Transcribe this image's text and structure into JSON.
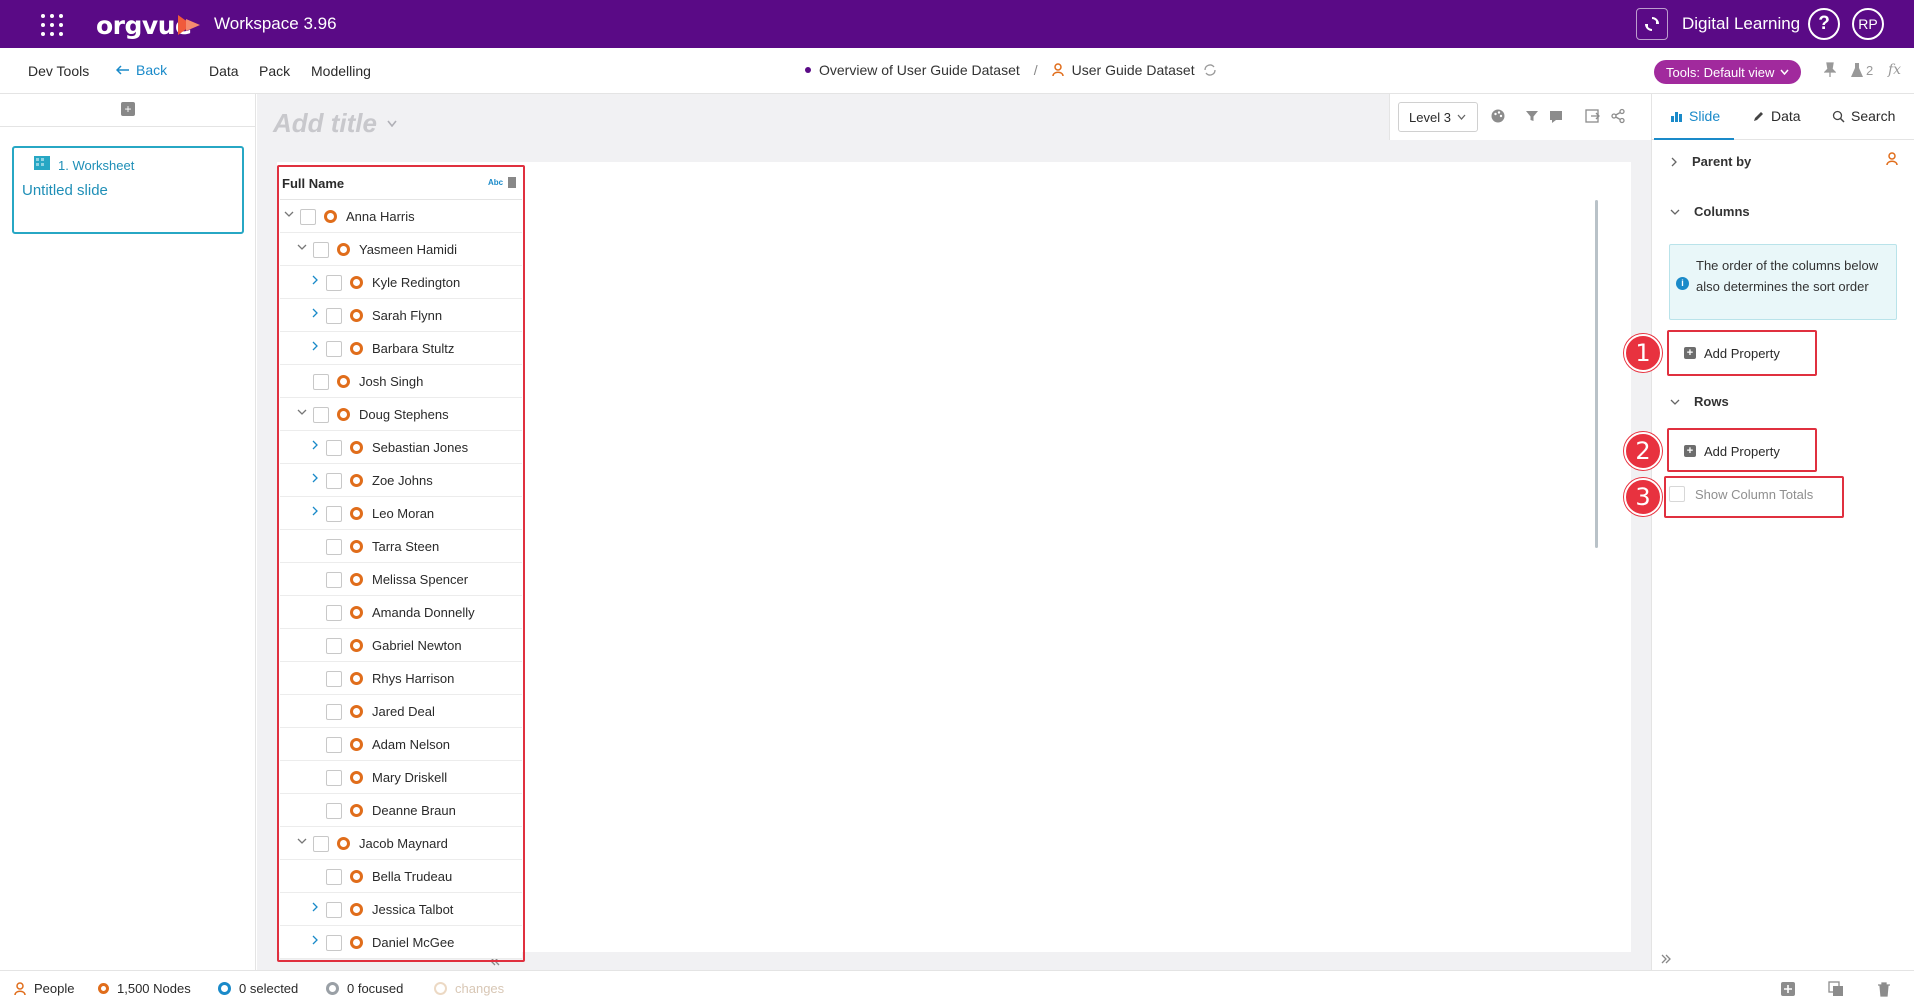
{
  "topbar": {
    "logo": "orgvue",
    "workspace": "Workspace  3.96",
    "org": "Digital Learning",
    "help": "?",
    "user_initials": "RP"
  },
  "menu": {
    "dev_tools": "Dev Tools",
    "back": "Back",
    "data": "Data",
    "pack": "Pack",
    "modelling": "Modelling",
    "breadcrumb_parent": "Overview of User Guide Dataset",
    "breadcrumb_sep": "/",
    "breadcrumb_current": "User Guide Dataset",
    "tools_view": "Tools: Default view",
    "flask_count": "2",
    "fx": "fx"
  },
  "left_panel": {
    "slide_number": "1. Worksheet",
    "slide_name": "Untitled slide"
  },
  "main": {
    "title_placeholder": "Add title",
    "level_select": "Level 3"
  },
  "table": {
    "header": "Full Name",
    "type_badge": "Abc",
    "rows": [
      {
        "name": "Anna Harris",
        "indent": 0,
        "chevron": "down"
      },
      {
        "name": "Yasmeen Hamidi",
        "indent": 1,
        "chevron": "down"
      },
      {
        "name": "Kyle Redington",
        "indent": 2,
        "chevron": "right"
      },
      {
        "name": "Sarah Flynn",
        "indent": 2,
        "chevron": "right"
      },
      {
        "name": "Barbara Stultz",
        "indent": 2,
        "chevron": "right"
      },
      {
        "name": "Josh Singh",
        "indent": 1,
        "chevron": "none"
      },
      {
        "name": "Doug Stephens",
        "indent": 1,
        "chevron": "down"
      },
      {
        "name": "Sebastian Jones",
        "indent": 2,
        "chevron": "right"
      },
      {
        "name": "Zoe Johns",
        "indent": 2,
        "chevron": "right"
      },
      {
        "name": "Leo Moran",
        "indent": 2,
        "chevron": "right"
      },
      {
        "name": "Tarra Steen",
        "indent": 2,
        "chevron": "none"
      },
      {
        "name": "Melissa Spencer",
        "indent": 2,
        "chevron": "none"
      },
      {
        "name": "Amanda Donnelly",
        "indent": 2,
        "chevron": "none"
      },
      {
        "name": "Gabriel Newton",
        "indent": 2,
        "chevron": "none"
      },
      {
        "name": "Rhys Harrison",
        "indent": 2,
        "chevron": "none"
      },
      {
        "name": "Jared Deal",
        "indent": 2,
        "chevron": "none"
      },
      {
        "name": "Adam Nelson",
        "indent": 2,
        "chevron": "none"
      },
      {
        "name": "Mary Driskell",
        "indent": 2,
        "chevron": "none"
      },
      {
        "name": "Deanne Braun",
        "indent": 2,
        "chevron": "none"
      },
      {
        "name": "Jacob Maynard",
        "indent": 1,
        "chevron": "down"
      },
      {
        "name": "Bella Trudeau",
        "indent": 2,
        "chevron": "none"
      },
      {
        "name": "Jessica Talbot",
        "indent": 2,
        "chevron": "right"
      },
      {
        "name": "Daniel McGee",
        "indent": 2,
        "chevron": "right"
      }
    ]
  },
  "right_panel": {
    "tab_slide": "Slide",
    "tab_data": "Data",
    "tab_search": "Search",
    "parent_by": "Parent by",
    "columns": "Columns",
    "info_text": "The order of the columns below also determines the sort order",
    "add_property_columns": "Add Property",
    "rows": "Rows",
    "add_property_rows": "Add Property",
    "show_column_totals": "Show Column Totals",
    "badges": [
      "1",
      "2",
      "3"
    ]
  },
  "status": {
    "people": "People",
    "nodes": "1,500 Nodes",
    "selected": "0 selected",
    "focused": "0 focused",
    "changes": "changes"
  },
  "colors": {
    "brand": "#5a0a86",
    "accent": "#1a8ac9",
    "node_ring": "#e06d1b",
    "annotation": "#e0303f",
    "tools_pill": "#a12a9d"
  }
}
